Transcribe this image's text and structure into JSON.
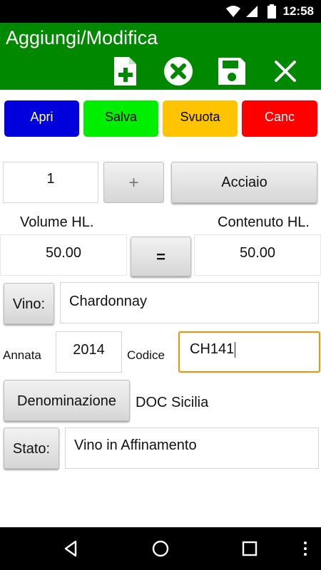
{
  "status_bar": {
    "time": "12:58"
  },
  "action_bar": {
    "title": "Aggiungi/Modifica",
    "color": "#008800"
  },
  "color_buttons": [
    {
      "label": "Apri",
      "color": "#0000dd",
      "text_color": "#ffffff"
    },
    {
      "label": "Salva",
      "color": "#00ee00",
      "text_color": "#000000"
    },
    {
      "label": "Svuota",
      "color": "#ffc400",
      "text_color": "#000000"
    },
    {
      "label": "Canc",
      "color": "#ff0000",
      "text_color": "#ffffff"
    }
  ],
  "container": {
    "quantity": "1",
    "plus_label": "+",
    "material_label": "Acciaio"
  },
  "volume": {
    "volume_label": "Volume HL.",
    "content_label": "Contenuto HL.",
    "volume_value": "50.00",
    "equals_label": "=",
    "content_value": "50.00"
  },
  "wine": {
    "vino_button": "Vino:",
    "vino_value": "Chardonnay",
    "annata_label": "Annata",
    "annata_value": "2014",
    "codice_label": "Codice",
    "codice_value": "CH141",
    "denominazione_button": "Denominazione",
    "denominazione_value": "DOC Sicilia",
    "stato_button": "Stato:",
    "stato_value": "Vino in Affinamento"
  },
  "icons": {
    "action_add": "add-document-icon",
    "action_cancel": "cancel-circle-icon",
    "action_save": "save-floppy-icon",
    "action_close": "close-icon",
    "nav_back": "back-triangle-icon",
    "nav_home": "home-circle-icon",
    "nav_recents": "recents-square-icon",
    "nav_menu": "menu-dots-icon"
  },
  "accent_focus_color": "#f39200"
}
